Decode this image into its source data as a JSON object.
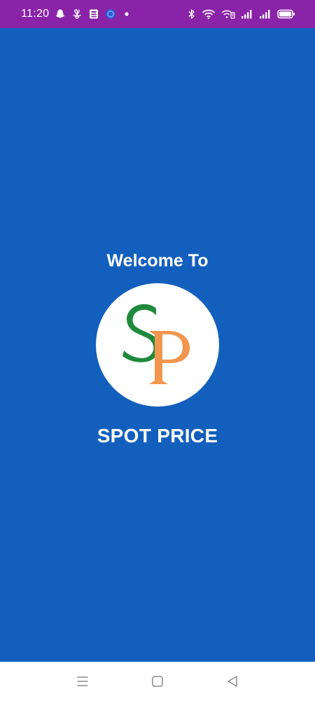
{
  "status_bar": {
    "time": "11:20",
    "left_icons": [
      "snapchat-icon",
      "fan-icon",
      "sim-card-icon",
      "app-badge-icon",
      "notification-dot-icon"
    ],
    "right_icons": [
      "bluetooth-icon",
      "wifi-icon",
      "volte-icon",
      "signal-icon",
      "signal-icon",
      "battery-icon"
    ],
    "background_color": "#8a23a8"
  },
  "splash": {
    "welcome": "Welcome To",
    "logo_letters": "SP",
    "app_name": "SPOT PRICE",
    "background_color": "#135fbd",
    "logo_colors": {
      "s": "#1f8a3c",
      "p": "#f2964f"
    }
  },
  "nav_bar": {
    "buttons": [
      "menu-icon",
      "home-icon",
      "back-icon"
    ]
  }
}
